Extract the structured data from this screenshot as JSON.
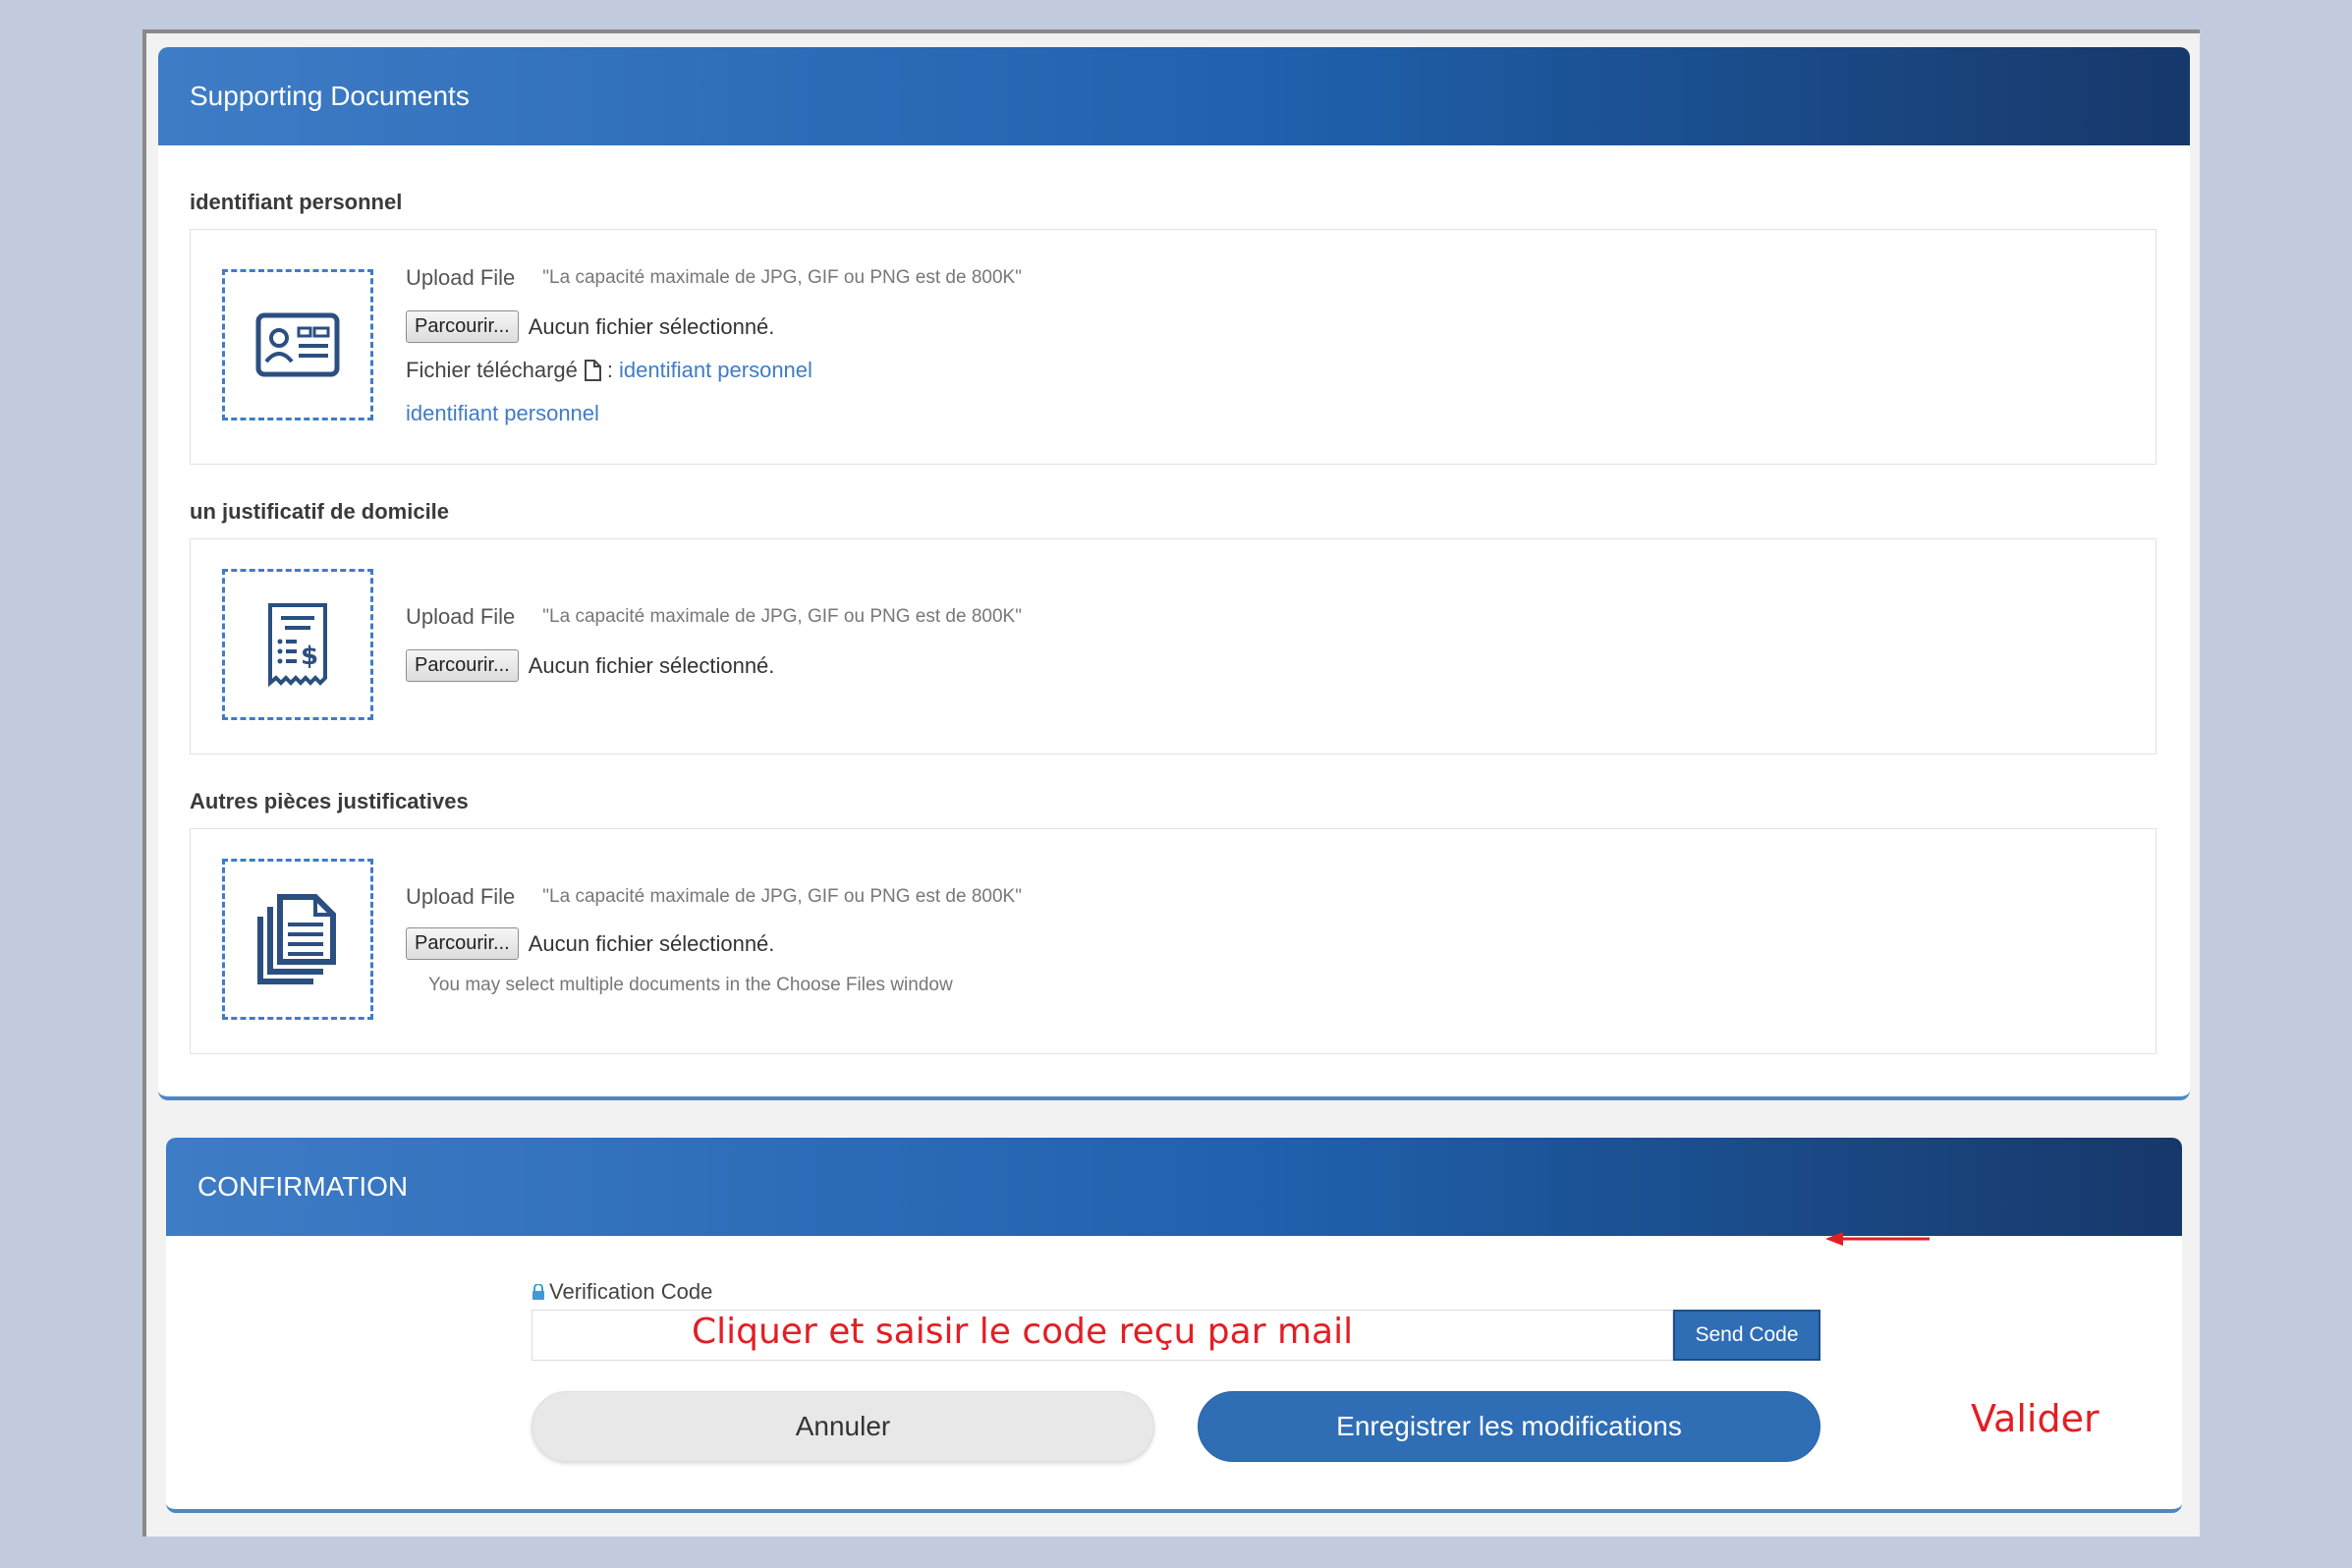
{
  "supporting": {
    "header": "Supporting Documents",
    "sections": [
      {
        "title": "identifiant personnel",
        "icon": "id-card-icon",
        "upload_label": "Upload File",
        "hint": "\"La capacité maximale de JPG, GIF ou PNG est de 800K\"",
        "browse_label": "Parcourir...",
        "no_file": "Aucun fichier sélectionné.",
        "uploaded_label": "Fichier téléchargé",
        "uploaded_sep": ":",
        "uploaded_link": "identifiant personnel",
        "extra_link": "identifiant personnel"
      },
      {
        "title": "un justificatif de domicile",
        "icon": "receipt-icon",
        "upload_label": "Upload File",
        "hint": "\"La capacité maximale de JPG, GIF ou PNG est de 800K\"",
        "browse_label": "Parcourir...",
        "no_file": "Aucun fichier sélectionné."
      },
      {
        "title": "Autres pièces justificatives",
        "icon": "documents-icon",
        "upload_label": "Upload File",
        "hint": "\"La capacité maximale de JPG, GIF ou PNG est de 800K\"",
        "browse_label": "Parcourir...",
        "no_file": "Aucun fichier sélectionné.",
        "multi_note": "You may select multiple documents in the Choose Files window"
      }
    ]
  },
  "confirmation": {
    "header": "CONFIRMATION",
    "verification_label": "Verification Code",
    "verification_value": "",
    "send_code": "Send Code",
    "cancel": "Annuler",
    "save": "Enregistrer les modifications"
  },
  "annotations": {
    "input_note": "Cliquer et saisir le code reçu par mail",
    "validate_note": "Valider",
    "color": "#e31e24"
  },
  "colors": {
    "accent": "#2f6db5",
    "header_dark": "#17386a",
    "link": "#3f7cc6"
  }
}
